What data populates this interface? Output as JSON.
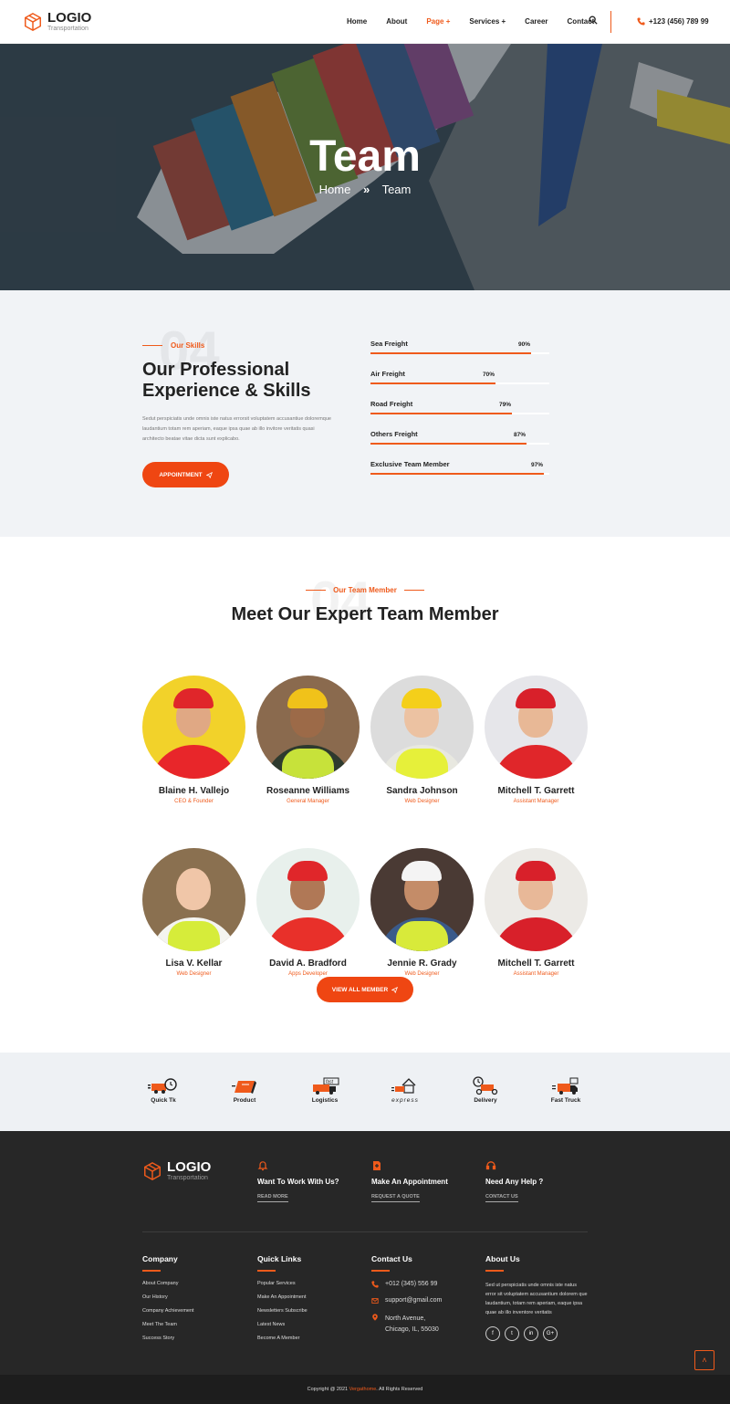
{
  "header": {
    "logo_name": "LOGIO",
    "logo_tagline": "Transportation",
    "nav": [
      {
        "label": "Home"
      },
      {
        "label": "About"
      },
      {
        "label": "Page +"
      },
      {
        "label": "Services +"
      },
      {
        "label": "Career"
      },
      {
        "label": "Contact"
      }
    ],
    "active_nav": "Page +",
    "phone": "+123 (456) 789 99"
  },
  "hero": {
    "title": "Team",
    "breadcrumb": {
      "home": "Home",
      "separator": "»",
      "current": "Team"
    }
  },
  "skills": {
    "kicker": "Our Skills",
    "bg_number": "04",
    "title": "Our Professional Experience & Skills",
    "description": "Sedut perspiciatis unde omnis iste natus errorsit voluptatem accusantiue doloremque laudantium totam rem aperiam, eaque ipsa quae ab illo invitore veritatis quasi architecto beatae vitae dicta sunt explicabo.",
    "button": "APPOINTMENT",
    "bars": [
      {
        "label": "Sea Freight",
        "percent": 90,
        "text": "90%"
      },
      {
        "label": "Air Freight",
        "percent": 70,
        "text": "70%"
      },
      {
        "label": "Road Freight",
        "percent": 79,
        "text": "79%"
      },
      {
        "label": "Others Freight",
        "percent": 87,
        "text": "87%"
      },
      {
        "label": "Exclusive Team Member",
        "percent": 97,
        "text": "97%"
      }
    ]
  },
  "team": {
    "kicker": "Our Team Member",
    "bg_number": "04",
    "title": "Meet Our Expert Team Member",
    "members": [
      {
        "name": "Blaine H. Vallejo",
        "role": "CEO & Founder"
      },
      {
        "name": "Roseanne Williams",
        "role": "General Manager"
      },
      {
        "name": "Sandra Johnson",
        "role": "Web Designer"
      },
      {
        "name": "Mitchell T. Garrett",
        "role": "Assistant Manager"
      },
      {
        "name": "Lisa V. Kellar",
        "role": "Web Designer"
      },
      {
        "name": "David A. Bradford",
        "role": "Apps Developer"
      },
      {
        "name": "Jennie R. Grady",
        "role": "Web Designer"
      },
      {
        "name": "Mitchell T. Garrett",
        "role": "Assistant Manager"
      }
    ],
    "button": "VIEW ALL MEMBER"
  },
  "brands": [
    {
      "label": "Quick Tk",
      "icon": "truck-clock-icon"
    },
    {
      "label": "Product",
      "icon": "box-icon"
    },
    {
      "label": "Logistics",
      "icon": "fast-truck-icon"
    },
    {
      "label": "express",
      "icon": "express-house-icon"
    },
    {
      "label": "Delivery",
      "icon": "delivery-scooter-icon"
    },
    {
      "label": "Fast Truck",
      "icon": "fast-truck-box-icon"
    }
  ],
  "footer": {
    "logo_name": "LOGIO",
    "logo_tagline": "Transportation",
    "ctas": [
      {
        "title": "Want To Work With Us?",
        "link": "READ MORE",
        "icon": "bell-icon"
      },
      {
        "title": "Make An Appointment",
        "link": "REQUEST A QUOTE",
        "icon": "document-plus-icon"
      },
      {
        "title": "Need Any Help ?",
        "link": "CONTACT US",
        "icon": "headset-icon"
      }
    ],
    "company": {
      "title": "Company",
      "links": [
        "About Company",
        "Our History",
        "Company Achievement",
        "Meet The Team",
        "Success Story"
      ]
    },
    "quick_links": {
      "title": "Quick Links",
      "links": [
        "Popular Services",
        "Make An Appointment",
        "Newsletters Subscribe",
        "Latest News",
        "Become A Member"
      ]
    },
    "contact": {
      "title": "Contact Us",
      "phone": "+012 (345) 556 99",
      "email": "support@gmail.com",
      "address_line1": "North Avenue,",
      "address_line2": "Chicago, IL, 55030"
    },
    "about": {
      "title": "About Us",
      "text": "Sed ut perspiciatis unde omnis iste natus error sit voluptatem accusantium dolorem que laudantium, totam rem aperiam, eaque ipsa quae ab illo inventore veritatis",
      "socials": [
        "f",
        "t",
        "in",
        "G+"
      ]
    },
    "copyright_prefix": "Copyright @ 2021",
    "copyright_brand": "Vergathome",
    "copyright_suffix": ". All Rights Reserved"
  },
  "colors": {
    "accent": "#ef5a1b",
    "footer_bg": "#272727"
  }
}
